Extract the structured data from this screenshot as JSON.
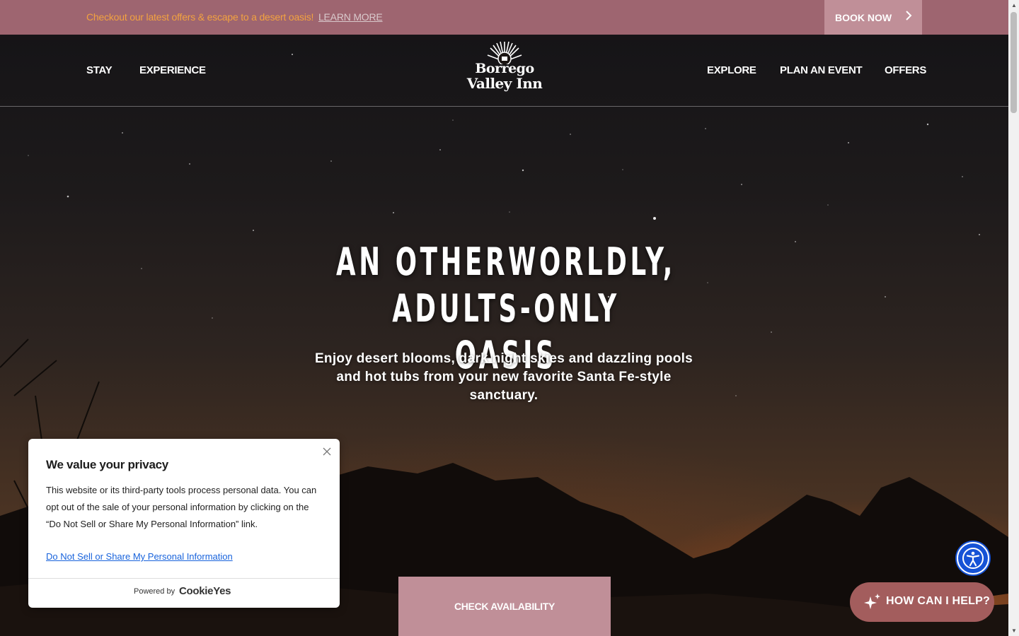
{
  "promo": {
    "text": "Checkout our latest offers & escape to a desert oasis!",
    "link": "LEARN MORE",
    "book_now": "BOOK NOW"
  },
  "nav": {
    "left": [
      "STAY",
      "EXPERIENCE"
    ],
    "right": [
      "EXPLORE",
      "PLAN AN EVENT",
      "OFFERS"
    ],
    "logo_line1": "Borrego",
    "logo_line2": "Valley Inn"
  },
  "hero": {
    "headline_line1": "AN OTHERWORLDLY, ADULTS-ONLY",
    "headline_line2": "OASIS",
    "subtitle": "Enjoy desert blooms, dark night skies and dazzling pools and hot tubs from your new favorite Santa Fe-style sanctuary.",
    "cta": "CHECK AVAILABILITY"
  },
  "cookie": {
    "title": "We value your privacy",
    "body": "This website or its third-party tools process personal data. You can opt out of the sale of your personal information by clicking on the “Do Not Sell or Share My Personal Information” link.",
    "link": "Do Not Sell or Share My Personal Information",
    "powered_by": "Powered by",
    "brand": "CookieYes",
    "close_icon": "close-icon"
  },
  "widgets": {
    "help_label": "HOW CAN I HELP?",
    "help_icon": "sparkle-icon",
    "a11y_icon": "accessibility-icon"
  },
  "colors": {
    "promo_bg": "#9e6570",
    "button_bg": "#c08f98",
    "promo_text": "#f2a240",
    "help_bg": "#a35d5d",
    "a11y_bg": "#1653d6"
  }
}
